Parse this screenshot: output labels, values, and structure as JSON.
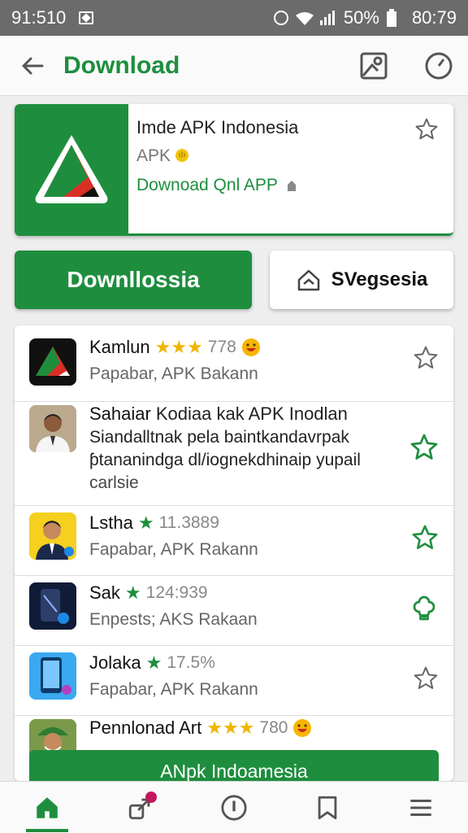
{
  "status_bar": {
    "time": "91:510",
    "battery": "50%",
    "clock_right": "80:79"
  },
  "app_bar": {
    "title": "Download",
    "icons": [
      "back-arrow-icon",
      "image-icon",
      "timer-icon"
    ]
  },
  "featured": {
    "title": "Imde APK Indonesia",
    "subtitle": "APK",
    "link": "Downoad Qnl APP",
    "colors": {
      "brand": "#1e8e3e",
      "logo_red": "#d93025"
    }
  },
  "actions": {
    "primary_label": "Downllossia",
    "secondary_label": "SVegsesia"
  },
  "list": [
    {
      "title": "Kamlun",
      "stars": "★★★",
      "rating": "778",
      "sub": "Papabar, APK Bakann"
    },
    {
      "title": "Sahaiar",
      "desc_title": "Kodiaa kak APK Inodlan",
      "desc_lines": [
        "Siandalltnak pela baintkandavrpak",
        "ƥtananindga dl/iognekdhinaip yupail",
        "carlsie"
      ]
    },
    {
      "title": "Lstha",
      "rating": "11.3889",
      "sub": "Fapabar, APK Rakann"
    },
    {
      "title": "Sak",
      "rating": "124:939",
      "sub": "Enpests; AKS Rakaan"
    },
    {
      "title": "Jolaka",
      "rating": "17.5%",
      "sub": "Fapabar, APK Rakann"
    },
    {
      "title": "Pennlonad Art",
      "stars": "★★★",
      "rating": "780"
    }
  ],
  "bottom_cta": "ANpk Indoamesia",
  "bottom_nav": [
    "home-icon",
    "share-icon",
    "info-icon",
    "bookmark-icon",
    "menu-icon"
  ]
}
